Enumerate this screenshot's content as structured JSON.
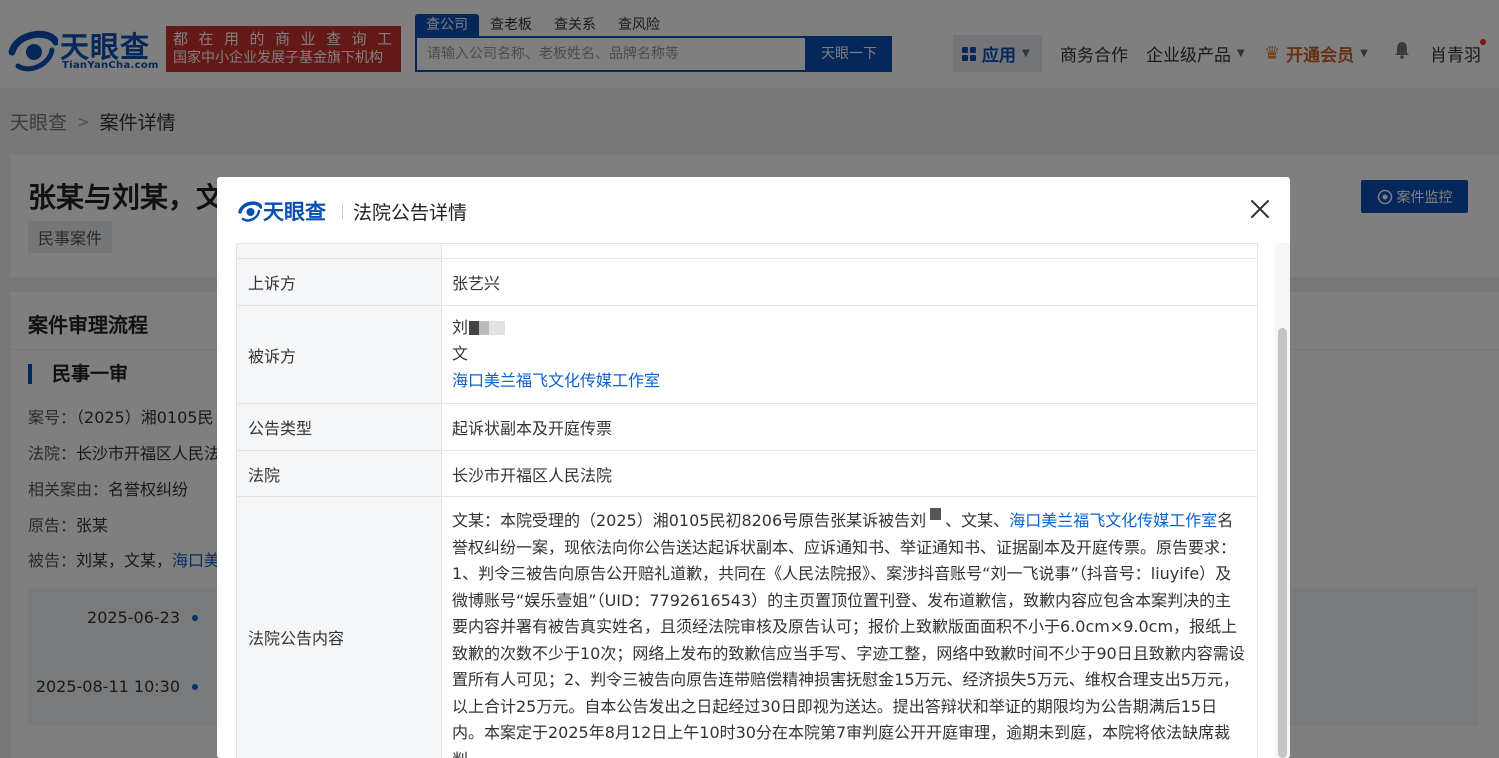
{
  "header": {
    "logo_cn": "天眼查",
    "logo_en": "TianYanCha.com",
    "slogan_line1": "都在用的商业查询工具",
    "slogan_line2": "国家中小企业发展子基金旗下机构",
    "search_tabs": [
      "查公司",
      "查老板",
      "查关系",
      "查风险"
    ],
    "search_placeholder": "请输入公司名称、老板姓名、品牌名称等",
    "search_button": "天眼一下",
    "apps_label": "应用",
    "business": "商务合作",
    "enterprise": "企业级产品",
    "vip": "开通会员",
    "user_name": "肖青羽"
  },
  "breadcrumb": {
    "home": "天眼查",
    "current": "案件详情"
  },
  "case": {
    "title": "张某与刘某，文",
    "tag": "民事案件",
    "monitor_button": "案件监控"
  },
  "process": {
    "section_title": "案件审理流程",
    "stage": "民事一审",
    "case_no_label": "案号：",
    "case_no": "（2025）湘0105民",
    "court_label": "法院：",
    "court": "长沙市开福区人民法",
    "cause_label": "相关案由：",
    "cause": "名誉权纠纷",
    "plaintiff_label": "原告：",
    "plaintiff": "张某",
    "defendant_label": "被告：",
    "defendant": "刘某，文某，",
    "defendant_link": "海口美",
    "timeline": [
      "2025-06-23",
      "2025-08-11 10:30"
    ]
  },
  "modal": {
    "logo": "天眼查",
    "title": "法院公告详情",
    "rows": {
      "appellant_label": "上诉方",
      "appellant": "张艺兴",
      "respondent_label": "被诉方",
      "respondent_1": "刘",
      "respondent_2": "文",
      "respondent_3": "海口美兰福飞文化传媒工作室",
      "type_label": "公告类型",
      "type": "起诉状副本及开庭传票",
      "court_label": "法院",
      "court": "长沙市开福区人民法院",
      "content_label": "法院公告内容",
      "content_prefix": "文某：本院受理的（2025）湘0105民初8206号原告张某诉被告刘",
      "content_mid": "、文某、",
      "content_link": "海口美兰福飞文化传媒工作室",
      "content_body": "名誉权纠纷一案，现依法向你公告送达起诉状副本、应诉通知书、举证通知书、证据副本及开庭传票。原告要求：1、判令三被告向原告公开赔礼道歉，共同在《人民法院报》、案涉抖音账号“刘一飞说事”（抖音号：liuyife）及微博账号“娱乐壹姐”（UID：7792616543）的主页置顶位置刊登、发布道歉信，致歉内容应包含本案判决的主要内容并署有被告真实姓名，且须经法院审核及原告认可；报价上致歉版面面积不小于6.0cm×9.0cm，报纸上致歉的次数不少于10次；网络上发布的致歉信应当手写、字迹工整，网络中致歉时间不少于90日且致歉内容需设置所有人可见；2、判令三被告向原告连带赔偿精神损害抚慰金15万元、经济损失5万元、维权合理支出5万元，以上合计25万元。自本公告发出之日起经过30日即视为送达。提出答辩状和举证的期限均为公告期满后15日内。本案定于2025年8月12日上午10时30分在本院第7审判庭公开开庭审理，逾期未到庭，本院将依法缺席裁判。"
    }
  },
  "colors": {
    "brand": "#0a4fb4",
    "slogan_bg": "#c8332f",
    "link": "#0a63cc"
  }
}
